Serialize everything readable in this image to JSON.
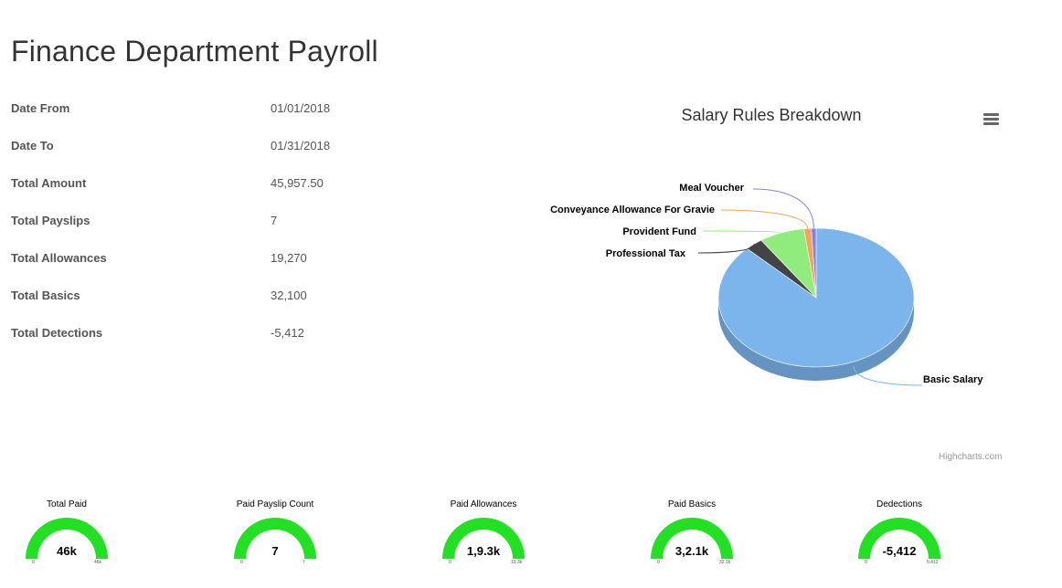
{
  "page": {
    "title": "Finance Department Payroll"
  },
  "summary": [
    {
      "label": "Date From",
      "value": "01/01/2018"
    },
    {
      "label": "Date To",
      "value": "01/31/2018"
    },
    {
      "label": "Total Amount",
      "value": "45,957.50"
    },
    {
      "label": "Total Payslips",
      "value": "7"
    },
    {
      "label": "Total Allowances",
      "value": "19,270"
    },
    {
      "label": "Total Basics",
      "value": "32,100"
    },
    {
      "label": "Total Detections",
      "value": "-5,412"
    }
  ],
  "chart_data": {
    "type": "pie",
    "title": "Salary Rules Breakdown",
    "slices": [
      {
        "name": "Basic Salary",
        "value": 87.5,
        "color": "#7cb5ec"
      },
      {
        "name": "Professional Tax",
        "value": 3.0,
        "color": "#434348"
      },
      {
        "name": "Provident Fund",
        "value": 7.5,
        "color": "#90ed7d"
      },
      {
        "name": "Conveyance Allowance For Gravie",
        "value": 1.2,
        "color": "#f7a35c"
      },
      {
        "name": "Meal Voucher",
        "value": 0.8,
        "color": "#8085e9"
      }
    ],
    "credits": "Highcharts.com",
    "menu_icon": "hamburger-menu-icon"
  },
  "gauges": [
    {
      "title": "Total Paid",
      "value": "46k",
      "min": "0",
      "max": "46k",
      "fraction": 1.0,
      "color": "#22e022"
    },
    {
      "title": "Paid Payslip Count",
      "value": "7",
      "min": "0",
      "max": "7",
      "fraction": 1.0,
      "color": "#22e022"
    },
    {
      "title": "Paid Allowances",
      "value": "1,9.3k",
      "min": "0",
      "max": "19.3k",
      "fraction": 1.0,
      "color": "#22e022"
    },
    {
      "title": "Paid Basics",
      "value": "3,2.1k",
      "min": "0",
      "max": "32.1k",
      "fraction": 1.0,
      "color": "#22e022"
    },
    {
      "title": "Dedections",
      "value": "-5,412",
      "min": "0",
      "max": "5,412",
      "fraction": 1.0,
      "color": "#22e022"
    }
  ]
}
